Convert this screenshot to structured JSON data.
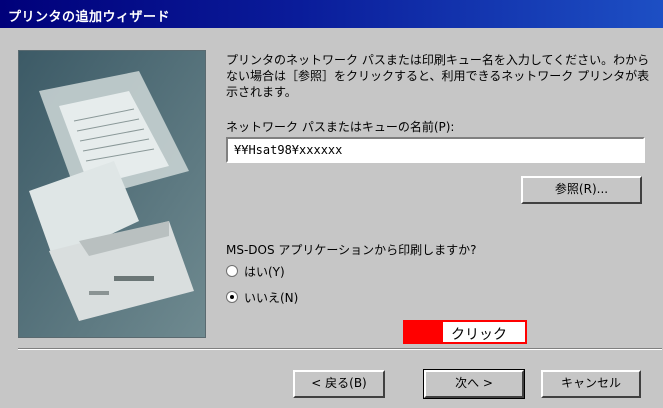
{
  "window": {
    "title": "プリンタの追加ウィザード"
  },
  "description": "プリンタのネットワーク パスまたは印刷キュー名を入力してください。わからない場合は［参照］をクリックすると、利用できるネットワーク プリンタが表示されます。",
  "path_field": {
    "label": "ネットワーク パスまたはキューの名前(P):",
    "value": "¥¥Hsat98¥xxxxxx"
  },
  "browse_button": "参照(R)...",
  "msdos": {
    "question": "MS-DOS アプリケーションから印刷しますか?",
    "options": [
      {
        "label": "はい(Y)",
        "selected": false
      },
      {
        "label": "いいえ(N)",
        "selected": true
      }
    ]
  },
  "annotation": {
    "label": "クリック",
    "color": "#ff0000"
  },
  "footer": {
    "back": "< 戻る(B)",
    "next": "次へ >",
    "cancel": "キャンセル"
  },
  "colors": {
    "title_start": "#00007a",
    "title_end": "#1d4fc4",
    "face": "#c6c6c6"
  }
}
